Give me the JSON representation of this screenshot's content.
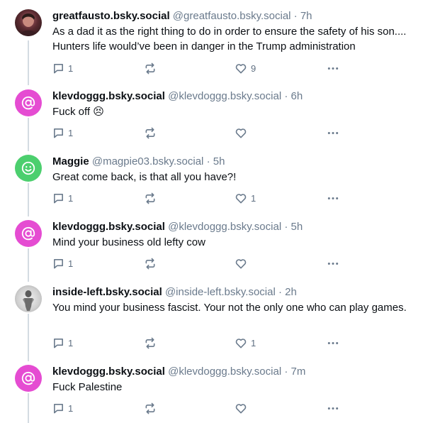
{
  "posts": [
    {
      "display_name": "greatfausto.bsky.social",
      "handle": "@greatfausto.bsky.social",
      "separator": "·",
      "time": "7h",
      "text": "As a dad it as the right thing to do in order to ensure the safety of his son.... Hunters life would’ve been in danger in the Trump administration",
      "reply_count": "1",
      "like_count": "9",
      "avatar": "photo-portrait"
    },
    {
      "display_name": "klevdoggg.bsky.social",
      "handle": "@klevdoggg.bsky.social",
      "separator": "·",
      "time": "6h",
      "text": "Fuck off 😣",
      "reply_count": "1",
      "like_count": "",
      "avatar": "default-at-avatar"
    },
    {
      "display_name": "Maggie",
      "handle": "@magpie03.bsky.social",
      "separator": "·",
      "time": "5h",
      "text": "Great come back, is that all you have?!",
      "reply_count": "1",
      "like_count": "1",
      "avatar": "smiley-avatar"
    },
    {
      "display_name": "klevdoggg.bsky.social",
      "handle": "@klevdoggg.bsky.social",
      "separator": "·",
      "time": "5h",
      "text": "Mind your business old lefty cow",
      "reply_count": "1",
      "like_count": "",
      "avatar": "default-at-avatar"
    },
    {
      "display_name": "inside-left.bsky.social",
      "handle": "@inside-left.bsky.social",
      "separator": "·",
      "time": "2h",
      "text": "You mind your business fascist. Your not the only one who can play games.",
      "reply_count": "1",
      "like_count": "1",
      "avatar": "photo-figure"
    },
    {
      "display_name": "klevdoggg.bsky.social",
      "handle": "@klevdoggg.bsky.social",
      "separator": "·",
      "time": "7m",
      "text": "Fuck Palestine",
      "reply_count": "1",
      "like_count": "",
      "avatar": "default-at-avatar"
    }
  ],
  "colors": {
    "at_avatar": "#e54cd2",
    "smile_avatar": "#4ccf6e",
    "muted_text": "#6a7a8c",
    "thread_line": "#d4dbe2"
  }
}
